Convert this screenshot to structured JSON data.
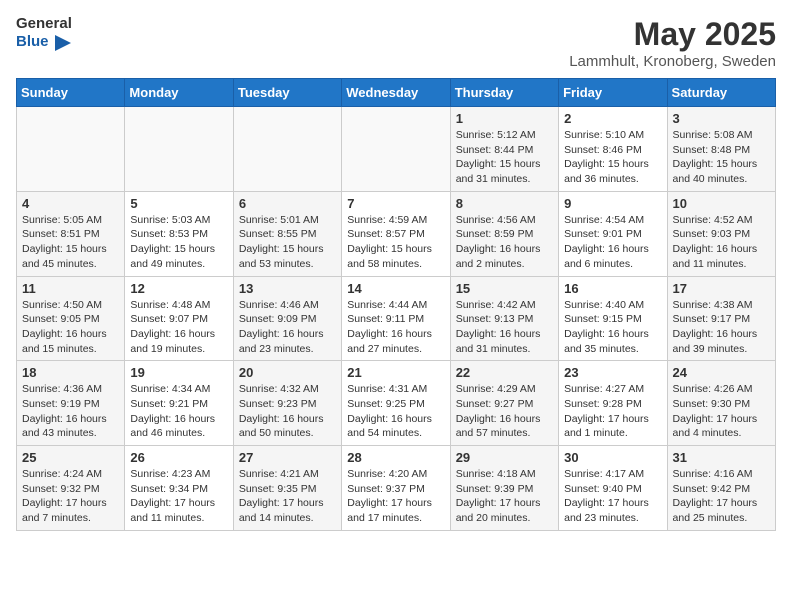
{
  "header": {
    "logo_general": "General",
    "logo_blue": "Blue",
    "title": "May 2025",
    "subtitle": "Lammhult, Kronoberg, Sweden"
  },
  "days_of_week": [
    "Sunday",
    "Monday",
    "Tuesday",
    "Wednesday",
    "Thursday",
    "Friday",
    "Saturday"
  ],
  "weeks": [
    [
      {
        "day": "",
        "info": ""
      },
      {
        "day": "",
        "info": ""
      },
      {
        "day": "",
        "info": ""
      },
      {
        "day": "",
        "info": ""
      },
      {
        "day": "1",
        "info": "Sunrise: 5:12 AM\nSunset: 8:44 PM\nDaylight: 15 hours\nand 31 minutes."
      },
      {
        "day": "2",
        "info": "Sunrise: 5:10 AM\nSunset: 8:46 PM\nDaylight: 15 hours\nand 36 minutes."
      },
      {
        "day": "3",
        "info": "Sunrise: 5:08 AM\nSunset: 8:48 PM\nDaylight: 15 hours\nand 40 minutes."
      }
    ],
    [
      {
        "day": "4",
        "info": "Sunrise: 5:05 AM\nSunset: 8:51 PM\nDaylight: 15 hours\nand 45 minutes."
      },
      {
        "day": "5",
        "info": "Sunrise: 5:03 AM\nSunset: 8:53 PM\nDaylight: 15 hours\nand 49 minutes."
      },
      {
        "day": "6",
        "info": "Sunrise: 5:01 AM\nSunset: 8:55 PM\nDaylight: 15 hours\nand 53 minutes."
      },
      {
        "day": "7",
        "info": "Sunrise: 4:59 AM\nSunset: 8:57 PM\nDaylight: 15 hours\nand 58 minutes."
      },
      {
        "day": "8",
        "info": "Sunrise: 4:56 AM\nSunset: 8:59 PM\nDaylight: 16 hours\nand 2 minutes."
      },
      {
        "day": "9",
        "info": "Sunrise: 4:54 AM\nSunset: 9:01 PM\nDaylight: 16 hours\nand 6 minutes."
      },
      {
        "day": "10",
        "info": "Sunrise: 4:52 AM\nSunset: 9:03 PM\nDaylight: 16 hours\nand 11 minutes."
      }
    ],
    [
      {
        "day": "11",
        "info": "Sunrise: 4:50 AM\nSunset: 9:05 PM\nDaylight: 16 hours\nand 15 minutes."
      },
      {
        "day": "12",
        "info": "Sunrise: 4:48 AM\nSunset: 9:07 PM\nDaylight: 16 hours\nand 19 minutes."
      },
      {
        "day": "13",
        "info": "Sunrise: 4:46 AM\nSunset: 9:09 PM\nDaylight: 16 hours\nand 23 minutes."
      },
      {
        "day": "14",
        "info": "Sunrise: 4:44 AM\nSunset: 9:11 PM\nDaylight: 16 hours\nand 27 minutes."
      },
      {
        "day": "15",
        "info": "Sunrise: 4:42 AM\nSunset: 9:13 PM\nDaylight: 16 hours\nand 31 minutes."
      },
      {
        "day": "16",
        "info": "Sunrise: 4:40 AM\nSunset: 9:15 PM\nDaylight: 16 hours\nand 35 minutes."
      },
      {
        "day": "17",
        "info": "Sunrise: 4:38 AM\nSunset: 9:17 PM\nDaylight: 16 hours\nand 39 minutes."
      }
    ],
    [
      {
        "day": "18",
        "info": "Sunrise: 4:36 AM\nSunset: 9:19 PM\nDaylight: 16 hours\nand 43 minutes."
      },
      {
        "day": "19",
        "info": "Sunrise: 4:34 AM\nSunset: 9:21 PM\nDaylight: 16 hours\nand 46 minutes."
      },
      {
        "day": "20",
        "info": "Sunrise: 4:32 AM\nSunset: 9:23 PM\nDaylight: 16 hours\nand 50 minutes."
      },
      {
        "day": "21",
        "info": "Sunrise: 4:31 AM\nSunset: 9:25 PM\nDaylight: 16 hours\nand 54 minutes."
      },
      {
        "day": "22",
        "info": "Sunrise: 4:29 AM\nSunset: 9:27 PM\nDaylight: 16 hours\nand 57 minutes."
      },
      {
        "day": "23",
        "info": "Sunrise: 4:27 AM\nSunset: 9:28 PM\nDaylight: 17 hours\nand 1 minute."
      },
      {
        "day": "24",
        "info": "Sunrise: 4:26 AM\nSunset: 9:30 PM\nDaylight: 17 hours\nand 4 minutes."
      }
    ],
    [
      {
        "day": "25",
        "info": "Sunrise: 4:24 AM\nSunset: 9:32 PM\nDaylight: 17 hours\nand 7 minutes."
      },
      {
        "day": "26",
        "info": "Sunrise: 4:23 AM\nSunset: 9:34 PM\nDaylight: 17 hours\nand 11 minutes."
      },
      {
        "day": "27",
        "info": "Sunrise: 4:21 AM\nSunset: 9:35 PM\nDaylight: 17 hours\nand 14 minutes."
      },
      {
        "day": "28",
        "info": "Sunrise: 4:20 AM\nSunset: 9:37 PM\nDaylight: 17 hours\nand 17 minutes."
      },
      {
        "day": "29",
        "info": "Sunrise: 4:18 AM\nSunset: 9:39 PM\nDaylight: 17 hours\nand 20 minutes."
      },
      {
        "day": "30",
        "info": "Sunrise: 4:17 AM\nSunset: 9:40 PM\nDaylight: 17 hours\nand 23 minutes."
      },
      {
        "day": "31",
        "info": "Sunrise: 4:16 AM\nSunset: 9:42 PM\nDaylight: 17 hours\nand 25 minutes."
      }
    ]
  ]
}
